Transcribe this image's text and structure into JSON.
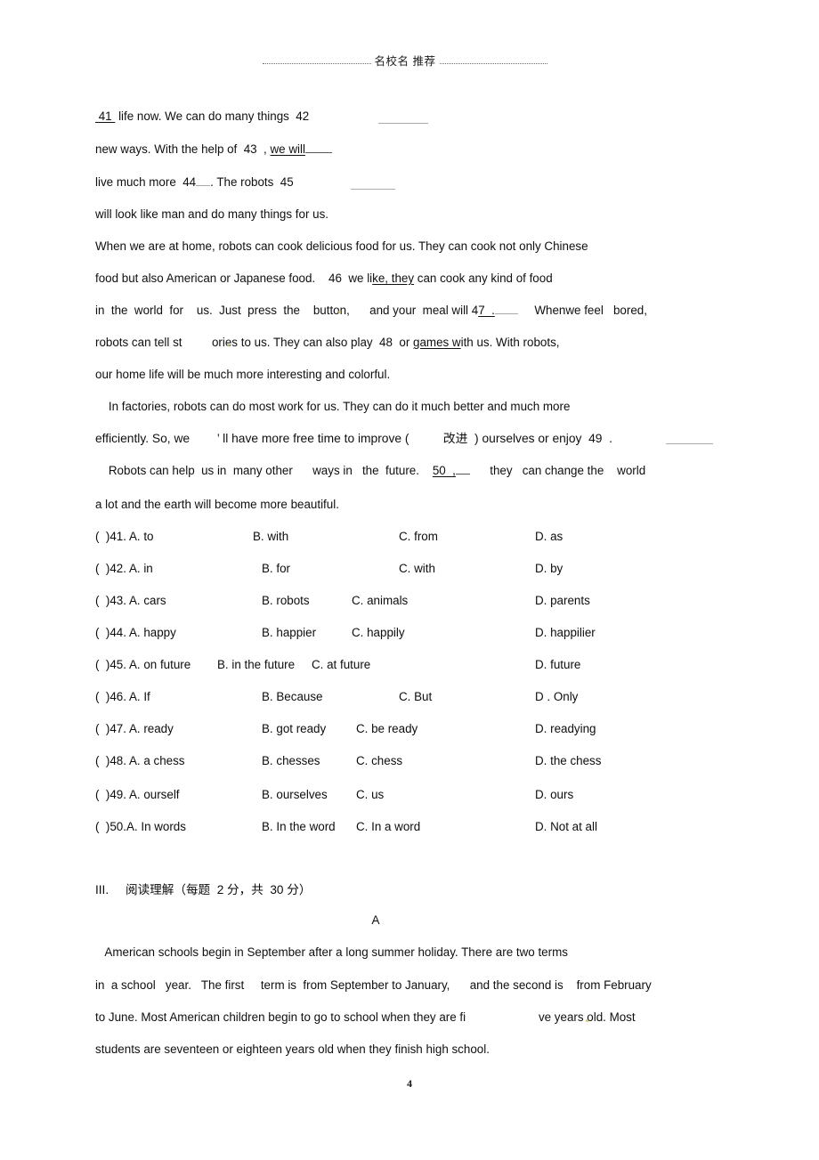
{
  "document": {
    "header_title": "名校名  推荐",
    "page_number": "4"
  },
  "cloze_passage": {
    "lines": [
      {
        "id": "l1",
        "pre": " 41 ",
        "post": " life now. We can do many things  42"
      },
      {
        "id": "l2",
        "pre": "new ways. With the help of  43  , ",
        "underlined": "we will",
        "post": ""
      },
      {
        "id": "l3",
        "pre": "live much more  44",
        "post": ". The robots  45"
      },
      {
        "id": "l4",
        "text": "will look like man and do many things for us."
      },
      {
        "id": "l5",
        "text": "When we are at home, robots can cook delicious food for us. They can cook not only Chinese"
      },
      {
        "id": "l6",
        "pre": "food but also American or Japanese food.    46  we li",
        "underlined": "ke, they",
        "post": " can cook any kind of food"
      },
      {
        "id": "l7",
        "pre": "in  the  world  for    us.  Just  press  the    button,      and your  meal will 4",
        "underlined": "7  .",
        "post": "     Whenwe feel   bored,"
      },
      {
        "id": "l8",
        "pre": "robots can tell st         ories to us. They can also play  48  or ",
        "underlined": "games w",
        "post": "ith us. With robots,"
      },
      {
        "id": "l9",
        "text": "our home life will be much more interesting and colorful."
      },
      {
        "id": "l10",
        "text": "    In factories, robots can do most work for us. They can do it much better and much more"
      },
      {
        "id": "l11",
        "text": "efficiently. So, we        ’ ll have more free time to improve (          改进  ) ourselves or enjoy  49  ."
      },
      {
        "id": "l12",
        "pre": "    Robots can help  us in  many other      ways in   the  future.    ",
        "underlined": "50  ,",
        "post": "      they   can change the    world"
      },
      {
        "id": "l13",
        "text": "a lot and the earth will become more beautiful."
      }
    ]
  },
  "choices": [
    {
      "num": "(  )41. A. to",
      "b": "B. with",
      "c": "C. from",
      "d": "D. as"
    },
    {
      "num": "(  )42. A. in",
      "b": "B. for",
      "c": "C. with",
      "d": "D. by"
    },
    {
      "num": "(  )43. A. cars",
      "b": "B. robots",
      "c": "C. animals",
      "d": "D. parents"
    },
    {
      "num": "(  )44. A. happy",
      "b": "B. happier",
      "c": "C. happily",
      "d": "D. happilier"
    },
    {
      "num": "(  )45. A. on future",
      "b": "B. in the future",
      "c": "C. at future",
      "d": "D. future"
    },
    {
      "num": "(  )46. A. If",
      "b": "B. Because",
      "c": "C. But",
      "d": "D . Only"
    },
    {
      "num": "(  )47. A. ready",
      "b": "B. got ready",
      "c": "C. be ready",
      "d": "D. readying"
    },
    {
      "num": "(  )48. A. a chess",
      "b": "B. chesses",
      "c": "C. chess",
      "d": "D. the chess"
    },
    {
      "num": "(  )49. A. ourself",
      "b": "B. ourselves",
      "c": "C. us",
      "d": "D. ours"
    },
    {
      "num": "(  )50.A. In words",
      "b": "B. In the word",
      "c": "C. In a word",
      "d": "D. Not at all"
    }
  ],
  "reading_section": {
    "heading": "III.     阅读理解（每题  2 分，共  30 分）",
    "passage_label": "A",
    "lines": [
      "   American schools begin in September after a long summer holiday. There are two terms",
      "in  a school   year.   The first     term is  from September to January,      and the second is    from February",
      "to June. Most American children begin to go to school when they are fi                      ve years old. Most",
      "students are seventeen or eighteen years old when they finish high school."
    ]
  }
}
